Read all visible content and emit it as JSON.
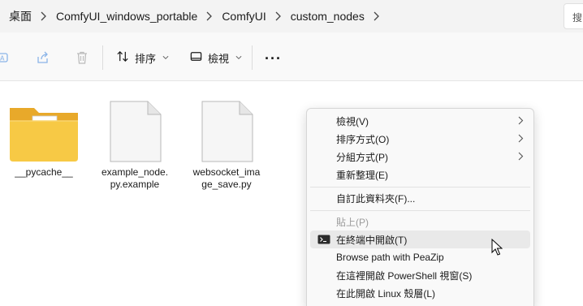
{
  "breadcrumb": {
    "items": [
      "桌面",
      "ComfyUI_windows_portable",
      "ComfyUI",
      "custom_nodes"
    ],
    "search_label": "搜"
  },
  "toolbar": {
    "sort_label": "排序",
    "view_label": "檢視",
    "more_label": "···",
    "icons": [
      "rename-icon",
      "share-icon",
      "delete-icon",
      "sort-icon",
      "view-icon",
      "more-icon"
    ]
  },
  "files": [
    {
      "name": "__pycache__",
      "kind": "folder"
    },
    {
      "name": "example_node.\npy.example",
      "kind": "file"
    },
    {
      "name": "websocket_ima\nge_save.py",
      "kind": "file"
    }
  ],
  "context_menu": {
    "items": [
      {
        "label": "檢視(V)",
        "submenu": true
      },
      {
        "label": "排序方式(O)",
        "submenu": true
      },
      {
        "label": "分組方式(P)",
        "submenu": true
      },
      {
        "label": "重新整理(E)",
        "submenu": false
      },
      {
        "label": "自訂此資料夾(F)...",
        "submenu": false
      },
      {
        "label": "貼上(P)",
        "disabled": true
      },
      {
        "label": "在終端中開啟(T)",
        "icon": "terminal-icon",
        "hovered": true
      },
      {
        "label": "Browse path with PeaZip"
      },
      {
        "label": "在這裡開啟 PowerShell 視窗(S)"
      },
      {
        "label": "在此開啟 Linux 殼層(L)"
      }
    ]
  },
  "colors": {
    "accent_folder": "#f5c33b",
    "menu_bg": "#f9f9f9",
    "hover_bg": "#e9e9e9",
    "disabled_text": "#9b9b9b"
  }
}
